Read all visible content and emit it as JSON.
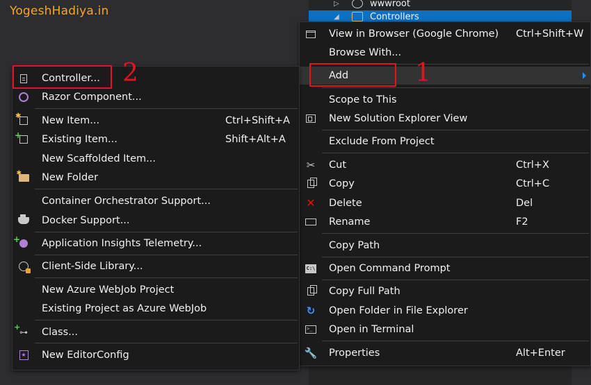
{
  "watermark": "YogeshHadiya.in",
  "solution_explorer": {
    "items": [
      {
        "label": "wwwroot",
        "icon": "globe-icon",
        "expanded": false
      },
      {
        "label": "Controllers",
        "icon": "folder-icon",
        "expanded": true,
        "selected": true
      }
    ]
  },
  "context_menu": {
    "items": [
      {
        "label": "View in Browser (Google Chrome)",
        "shortcut": "Ctrl+Shift+W",
        "icon": "browser-icon"
      },
      {
        "label": "Browse With...",
        "shortcut": ""
      },
      {
        "label": "Add",
        "shortcut": "",
        "has_submenu": true
      },
      {
        "label": "Scope to This",
        "shortcut": ""
      },
      {
        "label": "New Solution Explorer View",
        "shortcut": "",
        "icon": "solution-view-icon"
      },
      {
        "label": "Exclude From Project",
        "shortcut": ""
      },
      {
        "label": "Cut",
        "shortcut": "Ctrl+X",
        "icon": "cut-icon"
      },
      {
        "label": "Copy",
        "shortcut": "Ctrl+C",
        "icon": "copy-icon"
      },
      {
        "label": "Delete",
        "shortcut": "Del",
        "icon": "delete-icon"
      },
      {
        "label": "Rename",
        "shortcut": "F2",
        "icon": "rename-icon"
      },
      {
        "label": "Copy Path",
        "shortcut": ""
      },
      {
        "label": "Open Command Prompt",
        "shortcut": "",
        "icon": "command-prompt-icon"
      },
      {
        "label": "Copy Full Path",
        "shortcut": "",
        "icon": "copy-icon"
      },
      {
        "label": "Open Folder in File Explorer",
        "shortcut": "",
        "icon": "refresh-icon"
      },
      {
        "label": "Open in Terminal",
        "shortcut": "",
        "icon": "terminal-icon"
      },
      {
        "label": "Properties",
        "shortcut": "Alt+Enter",
        "icon": "wrench-icon"
      }
    ]
  },
  "add_submenu": {
    "items": [
      {
        "label": "Controller...",
        "shortcut": "",
        "icon": "document-icon"
      },
      {
        "label": "Razor Component...",
        "shortcut": "",
        "icon": "razor-icon"
      },
      {
        "label": "New Item...",
        "shortcut": "Ctrl+Shift+A",
        "icon": "new-item-icon"
      },
      {
        "label": "Existing Item...",
        "shortcut": "Shift+Alt+A",
        "icon": "existing-item-icon"
      },
      {
        "label": "New Scaffolded Item...",
        "shortcut": ""
      },
      {
        "label": "New Folder",
        "shortcut": "",
        "icon": "new-folder-icon"
      },
      {
        "label": "Container Orchestrator Support...",
        "shortcut": ""
      },
      {
        "label": "Docker Support...",
        "shortcut": "",
        "icon": "docker-icon"
      },
      {
        "label": "Application Insights Telemetry...",
        "shortcut": "",
        "icon": "insights-icon"
      },
      {
        "label": "Client-Side Library...",
        "shortcut": "",
        "icon": "library-icon"
      },
      {
        "label": "New Azure WebJob Project",
        "shortcut": ""
      },
      {
        "label": "Existing Project as Azure WebJob",
        "shortcut": ""
      },
      {
        "label": "Class...",
        "shortcut": "",
        "icon": "class-icon"
      },
      {
        "label": "New EditorConfig",
        "shortcut": "",
        "icon": "editorconfig-icon"
      }
    ]
  },
  "annotations": {
    "step_1": "1",
    "step_2": "2"
  },
  "colors": {
    "menu_bg": "#1b1b1c",
    "highlight": "#333334",
    "selection": "#0e70c0",
    "annotation": "#e81123",
    "watermark": "#f6a623"
  }
}
